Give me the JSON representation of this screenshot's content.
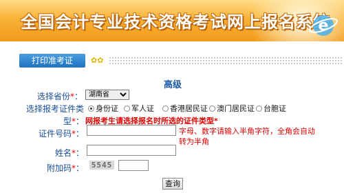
{
  "header": {
    "title": "全国会计专业技术资格考试网上报名系统",
    "logo_letter": "e"
  },
  "tabs": {
    "print_ticket": "打印准考证"
  },
  "form": {
    "level": "高级",
    "province_label": "选择省份",
    "province_value": "湖南省",
    "id_type_label_1": "选择报考证件类",
    "id_type_label_2": "型",
    "id_types": [
      "身份证",
      "军人证",
      "香港居民证",
      "澳门居民证",
      "台胞证"
    ],
    "id_type_warning": "网报考生请选择报名时所选的证件类型",
    "id_number_label": "证件号码",
    "id_number_value": "",
    "id_number_hint": "字母、数字请输入半角字符，全角会自动转为半角",
    "name_label": "姓名",
    "name_value": "",
    "captcha_label": "附加码",
    "captcha_text": "5545",
    "captcha_value": "",
    "required_mark": "*",
    "colon": "：",
    "submit_label": "查询"
  }
}
